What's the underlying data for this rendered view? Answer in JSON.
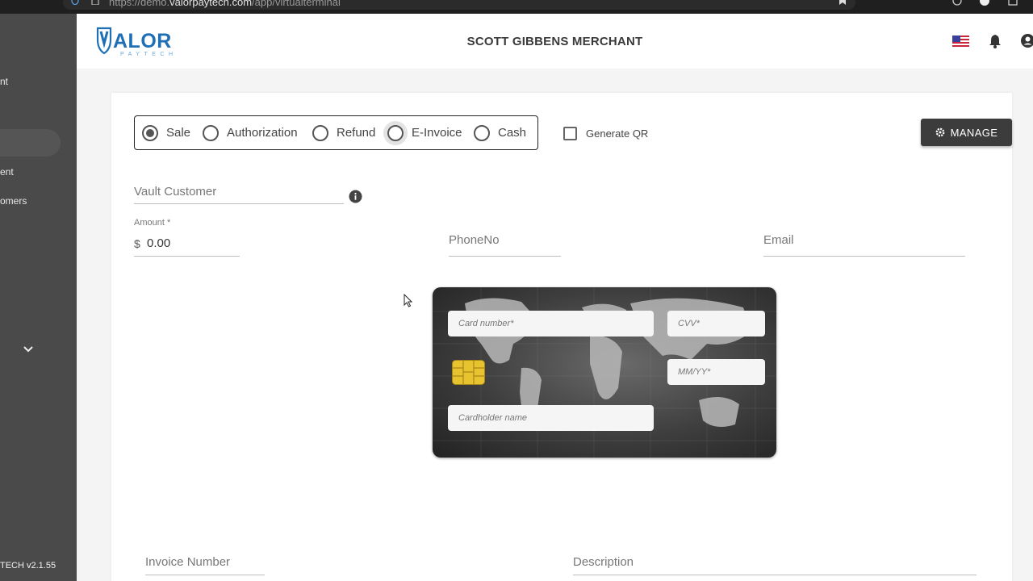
{
  "browser": {
    "url_prefix": "https://demo.",
    "url_domain": "valorpaytech.com",
    "url_path": "/app/virtualterminal"
  },
  "sidebar": {
    "items": [
      {
        "label": "nt"
      },
      {
        "label": "ent"
      },
      {
        "label": "omers"
      }
    ],
    "version": "TECH v2.1.55"
  },
  "header": {
    "merchant_name": "SCOTT GIBBENS MERCHANT",
    "logo_text": "VALOR",
    "logo_subtext": "PAYTECH"
  },
  "transaction_types": [
    {
      "label": "Sale",
      "checked": true
    },
    {
      "label": "Authorization",
      "checked": false
    },
    {
      "label": "Refund",
      "checked": false
    },
    {
      "label": "E-Invoice",
      "checked": false
    },
    {
      "label": "Cash",
      "checked": false
    }
  ],
  "generate_qr": {
    "label": "Generate QR",
    "checked": false
  },
  "manage_button": {
    "label": "MANAGE"
  },
  "form": {
    "vault_customer_placeholder": "Vault Customer",
    "amount_label": "Amount *",
    "currency_symbol": "$",
    "amount_value": "0.00",
    "phone_placeholder": "PhoneNo",
    "email_placeholder": "Email",
    "invoice_number_placeholder": "Invoice Number",
    "description_placeholder": "Description"
  },
  "card": {
    "card_number_placeholder": "Card number*",
    "cvv_placeholder": "CVV*",
    "expiry_placeholder": "MM/YY*",
    "cardholder_placeholder": "Cardholder name"
  },
  "colors": {
    "sidebar": "#4a4a4a",
    "manage_button": "#3c3c3c",
    "logo_blue": "#1f6fb5",
    "chip_gold": "#e8c330"
  }
}
